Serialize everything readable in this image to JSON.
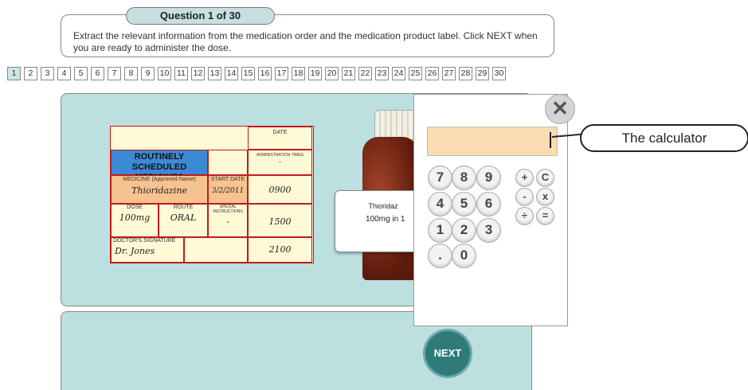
{
  "header": {
    "question_title": "Question 1 of 30",
    "instructions": "Extract the relevant information from the medication order and the medication product label. Click NEXT when you are ready to administer the dose."
  },
  "nav": [
    "1",
    "2",
    "3",
    "4",
    "5",
    "6",
    "7",
    "8",
    "9",
    "10",
    "11",
    "12",
    "13",
    "14",
    "15",
    "16",
    "17",
    "18",
    "19",
    "20",
    "21",
    "22",
    "23",
    "24",
    "25",
    "26",
    "27",
    "28",
    "29",
    "30"
  ],
  "chart": {
    "title": "ROUTINELY SCHEDULED MEDICINES",
    "date_label": "DATE",
    "admin_times_label": "ADMINISTRATION TIMES",
    "admin_dash": "-",
    "medicine_label": "MEDICINE (Approved Name)",
    "medicine": "Thioridazine",
    "start_date_label": "START DATE",
    "start_date": "3/2/2011",
    "dose_label": "DOSE",
    "dose": "100mg",
    "route_label": "ROUTE",
    "route": "ORAL",
    "special_label": "SPECIAL INSTRUCTIONS",
    "special": "-",
    "doctor_label": "DOCTOR'S SIGNATURE",
    "doctor": "Dr. Jones",
    "times": [
      "0900",
      "1500",
      "2100"
    ]
  },
  "product_label": {
    "name": "Thioridaz",
    "amount": "100mg in 1"
  },
  "calculator": {
    "close": "✕",
    "digits": [
      [
        "7",
        "8",
        "9"
      ],
      [
        "4",
        "5",
        "6"
      ],
      [
        "1",
        "2",
        "3"
      ],
      [
        ".",
        "0"
      ]
    ],
    "ops": [
      [
        "+",
        "C"
      ],
      [
        "-",
        "x"
      ],
      [
        "÷",
        "="
      ]
    ]
  },
  "callout": "The calculator",
  "next_label": "NEXT"
}
